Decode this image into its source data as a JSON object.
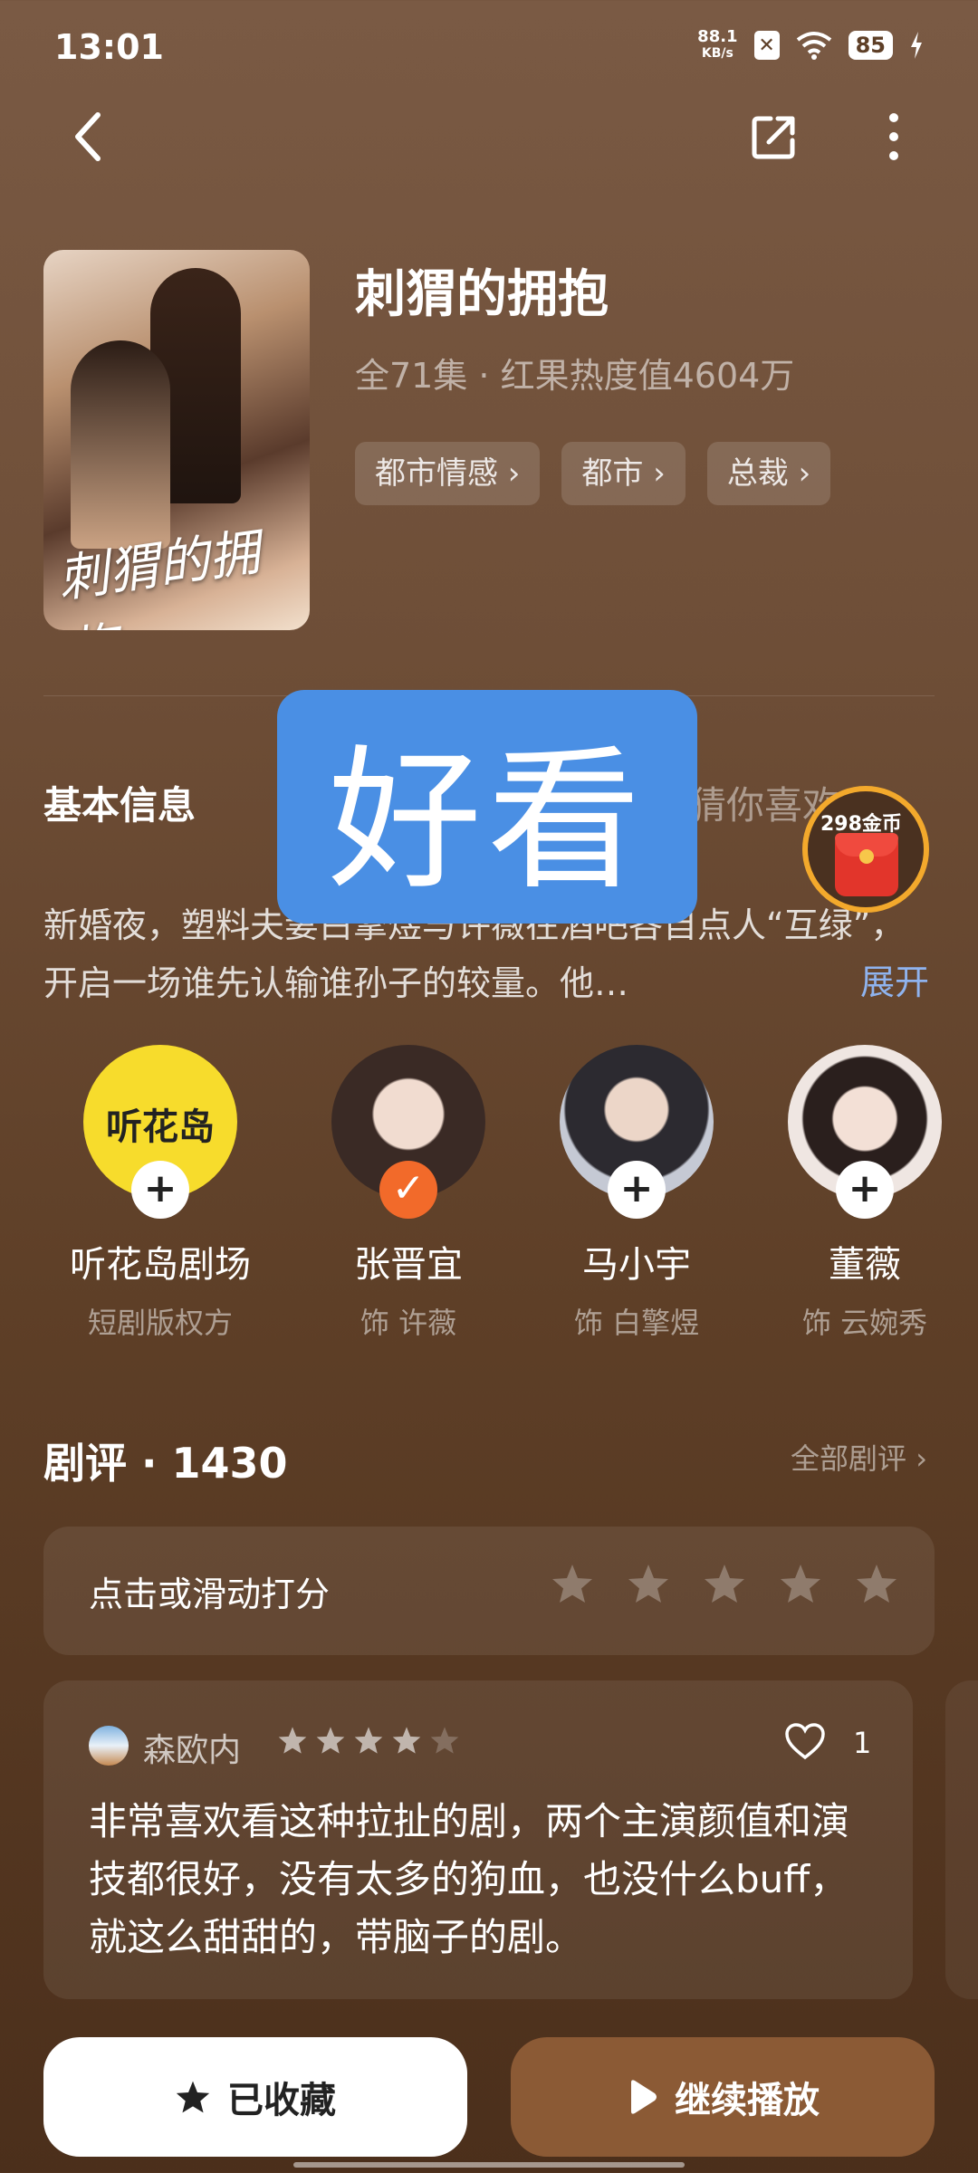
{
  "status_bar": {
    "time": "13:01",
    "net_speed_value": "88.1",
    "net_speed_unit": "KB/s",
    "battery": "85"
  },
  "drama": {
    "title": "刺猬的拥抱",
    "meta": "全71集 · 红果热度值4604万",
    "tags": [
      "都市情感 ›",
      "都市 ›",
      "总裁 ›"
    ],
    "poster_title": "刺猬的拥抱"
  },
  "tabs": {
    "basic_info": "基本信息",
    "guess_you_like": "猜你喜欢"
  },
  "overlay_label": "好看",
  "coin_badge": "298金币",
  "description": "新婚夜，塑料夫妻白擎煜与许薇在酒吧各自点人“互绿”，开启一场谁先认输谁孙子的较量。他…",
  "expand_label": "展开",
  "cast": [
    {
      "name": "听花岛剧场",
      "role": "短剧版权方",
      "logo_text": "听花岛",
      "followed": false
    },
    {
      "name": "张晋宜",
      "role": "饰 许薇",
      "followed": true
    },
    {
      "name": "马小宇",
      "role": "饰 白擎煜",
      "followed": false
    },
    {
      "name": "董薇",
      "role": "饰 云婉秀",
      "followed": false
    }
  ],
  "reviews": {
    "title": "剧评 · 1430",
    "all_label": "全部剧评 ›",
    "rate_prompt": "点击或滑动打分",
    "items": [
      {
        "user": "森欧内",
        "stars": 4,
        "likes": "1",
        "text": "非常喜欢看这种拉扯的剧，两个主演颜值和演技都很好，没有太多的狗血，也没什么buff，就这么甜甜的，带脑子的剧。"
      }
    ]
  },
  "bottom": {
    "favorite_label": "已收藏",
    "play_label": "继续播放"
  },
  "colors": {
    "overlay_blue": "#4a8fe4",
    "expand_blue": "#8fb3ee",
    "follow_orange": "#f26a2a",
    "play_button": "#8b5a35",
    "coin_ring": "#f3a92c"
  }
}
